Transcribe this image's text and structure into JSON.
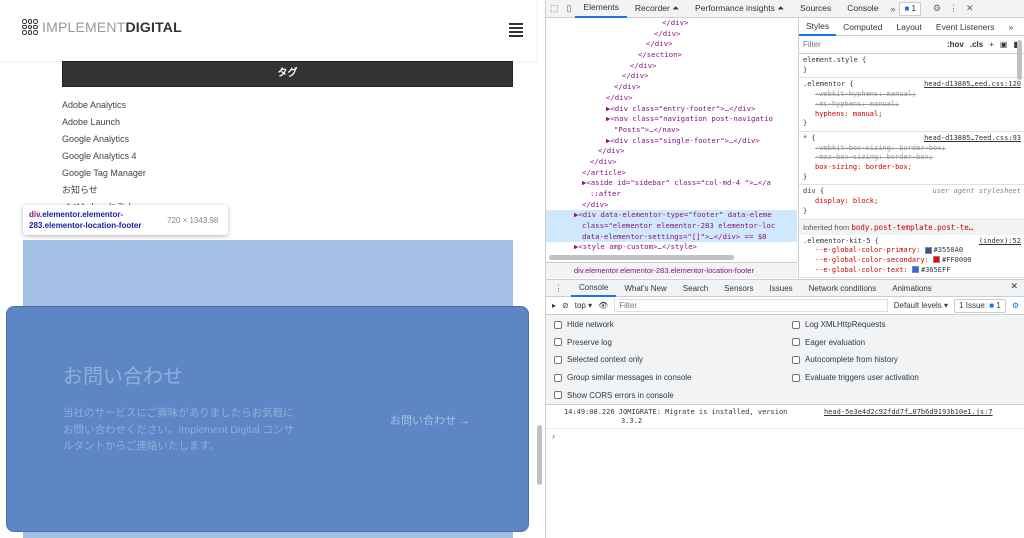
{
  "site": {
    "logo_light": "IMPLEMENT",
    "logo_bold": "DIGITAL",
    "tag_heading": "タグ",
    "tags": [
      "Adobe Analytics",
      "Adobe Launch",
      "Google Analytics",
      "Google Analytics 4",
      "Google Tag Manager",
      "お知らせ",
      "イベント・セミナー"
    ],
    "contact_title": "お問い合わせ",
    "contact_body": "当社のサービスにご興味がありましたらお気軽にお問い合わせください。Implement Digital コンサルタントからご連絡いたします。",
    "contact_link": "お問い合わせ →"
  },
  "tooltip": {
    "tag": "div",
    "selector": ".elementor.elementor-283.elementor-location-footer",
    "size": "720 × 1343.98"
  },
  "devtools": {
    "tabs": [
      "Elements",
      "Recorder ⏶",
      "Performance insights ⏶",
      "Sources",
      "Console"
    ],
    "issues_count": "1",
    "dom": [
      {
        "i": 14,
        "t": "</div>"
      },
      {
        "i": 13,
        "t": "</div>"
      },
      {
        "i": 12,
        "t": "</div>"
      },
      {
        "i": 11,
        "t": "</section>"
      },
      {
        "i": 10,
        "t": "</div>"
      },
      {
        "i": 9,
        "t": "</div>"
      },
      {
        "i": 8,
        "t": "</div>"
      },
      {
        "i": 7,
        "t": "</div>"
      },
      {
        "i": 7,
        "t": "▶<div class=\"entry-footer\">…</div>"
      },
      {
        "i": 7,
        "t": "▶<nav class=\"navigation post-navigatio"
      },
      {
        "i": 8,
        "t": "\"Posts\">…</nav>"
      },
      {
        "i": 7,
        "t": "▶<div class=\"single-footer\">…</div>"
      },
      {
        "i": 6,
        "t": "</div>"
      },
      {
        "i": 5,
        "t": "</div>"
      },
      {
        "i": 4,
        "t": "</article>"
      },
      {
        "i": 4,
        "t": "▶<aside id=\"sidebar\" class=\"col-md-4 \">…</a"
      },
      {
        "i": 5,
        "t": "::after"
      },
      {
        "i": 4,
        "t": "</div>"
      },
      {
        "i": 3,
        "t": "▶<div data-elementor-type=\"footer\" data-eleme",
        "sel": true
      },
      {
        "i": 4,
        "t": "class=\"elementor elementor-283 elementor-loc",
        "sel": true
      },
      {
        "i": 4,
        "t": "data-elementor-settings=\"[]\">…</div> == $0",
        "sel": true
      },
      {
        "i": 3,
        "t": "▶<style amp-custom>…</style>"
      }
    ],
    "breadcrumb": "div.elementor.elementor-283.elementor-location-footer",
    "styles_tabs": [
      "Styles",
      "Computed",
      "Layout",
      "Event Listeners",
      "»"
    ],
    "styles_filter": "Filter",
    "hov": ":hov",
    "cls": ".cls",
    "rules": [
      {
        "sel": "element.style {",
        "src": "",
        "props": [],
        "close": "}"
      },
      {
        "sel": ".elementor {",
        "src": "head-d13885…eed.css:120",
        "props": [
          {
            "t": "-webkit-hyphens: manual;",
            "s": true,
            "w": true
          },
          {
            "t": "-ms-hyphens: manual;",
            "s": true
          },
          {
            "t": "hyphens: manual;"
          }
        ],
        "close": "}"
      },
      {
        "sel": "* {",
        "src": "head-d13885…7eed.css:93",
        "props": [
          {
            "t": "-webkit-box-sizing: border-box;",
            "s": true
          },
          {
            "t": "-moz-box-sizing: border-box;",
            "s": true
          },
          {
            "t": "box-sizing: border-box;"
          }
        ],
        "close": "}"
      },
      {
        "sel": "div {",
        "src": "user agent stylesheet",
        "props": [
          {
            "t": "display: block;"
          }
        ],
        "close": "}"
      }
    ],
    "inherited_label": "Inherited from",
    "inherited_from": "body.post-template.post-te…",
    "kit_sel": ".elementor-kit-5 {",
    "kit_src": "(index):52",
    "vars": [
      {
        "n": "--e-global-color-primary:",
        "v": "#3550A0"
      },
      {
        "n": "--e-global-color-secondary:",
        "v": "#FF0000"
      },
      {
        "n": "--e-global-color-text:",
        "v": "#365EFF"
      }
    ],
    "drawer_tabs": [
      "Console",
      "What's New",
      "Search",
      "Sensors",
      "Issues",
      "Network conditions",
      "Animations"
    ],
    "context": "top ▾",
    "filter_placeholder": "Filter",
    "levels": "Default levels ▾",
    "issue_label": "1 Issue:",
    "issue_count": "1",
    "settings_left": [
      "Hide network",
      "Preserve log",
      "Selected context only",
      "Group similar messages in console",
      "Show CORS errors in console"
    ],
    "settings_right": [
      "Log XMLHttpRequests",
      "Eager evaluation",
      "Autocomplete from history",
      "Evaluate triggers user activation"
    ],
    "log": {
      "time": "14:49:08.226",
      "msg": "JQMIGRATE: Migrate is installed, version",
      "msg2": "3.3.2",
      "src": "head-5e3e4d2c92fdd7f…07b6d9193b10e1.js:7"
    }
  }
}
